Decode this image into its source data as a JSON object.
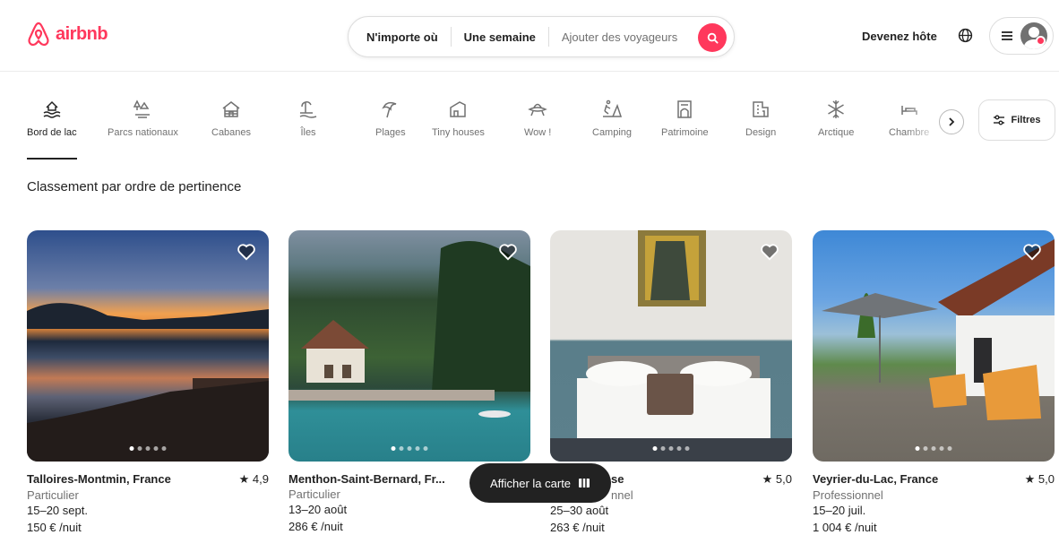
{
  "brand": {
    "name": "airbnb",
    "color": "#ff385c"
  },
  "search": {
    "where": "N'importe où",
    "when": "Une semaine",
    "guests": "Ajouter des voyageurs",
    "icon": "search-icon"
  },
  "header": {
    "host_link": "Devenez hôte",
    "globe_icon": "globe-icon",
    "menu_icon": "hamburger-icon"
  },
  "categories": [
    {
      "label": "Bord de lac",
      "icon": "lake-icon",
      "active": true
    },
    {
      "label": "Parcs nationaux",
      "icon": "park-icon"
    },
    {
      "label": "Cabanes",
      "icon": "cabin-icon"
    },
    {
      "label": "Îles",
      "icon": "island-icon"
    },
    {
      "label": "Plages",
      "icon": "beach-icon"
    },
    {
      "label": "Tiny houses",
      "icon": "tiny-house-icon"
    },
    {
      "label": "Wow !",
      "icon": "ufo-icon"
    },
    {
      "label": "Camping",
      "icon": "camping-icon"
    },
    {
      "label": "Patrimoine",
      "icon": "heritage-icon"
    },
    {
      "label": "Design",
      "icon": "design-icon"
    },
    {
      "label": "Arctique",
      "icon": "snowflake-icon"
    },
    {
      "label": "Chambre",
      "icon": "bed-icon"
    }
  ],
  "filters_label": "Filtres",
  "sort_label": "Classement par ordre de pertinence",
  "listings": [
    {
      "title": "Talloires-Montmin, France",
      "rating": "4,9",
      "host": "Particulier",
      "dates": "15–20 sept.",
      "price": "150 € /nuit"
    },
    {
      "title": "Menthon-Saint-Bernard, Fr...",
      "rating": "",
      "host": "Particulier",
      "dates": "13–20 août",
      "price": "286 € /nuit"
    },
    {
      "title": "se",
      "rating": "5,0",
      "host": "nnel",
      "dates": "25–30 août",
      "price": "263 € /nuit"
    },
    {
      "title": "Veyrier-du-Lac, France",
      "rating": "5,0",
      "host": "Professionnel",
      "dates": "15–20 juil.",
      "price": "1 004 € /nuit"
    }
  ],
  "map_button": "Afficher la carte"
}
